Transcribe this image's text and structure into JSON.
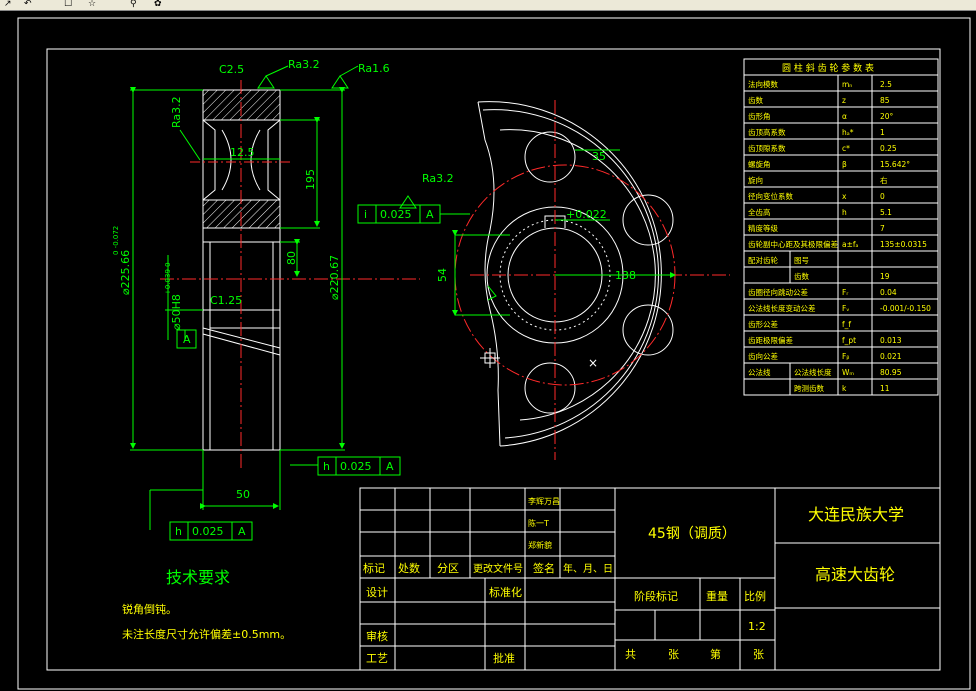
{
  "toolbar": {
    "icons": [
      "arrow-icon",
      "undo-icon",
      "checkbox-icon",
      "star-icon",
      "pin-icon",
      "palette-icon"
    ]
  },
  "colors": {
    "background": "#000000",
    "border": "#ffffff",
    "part": "#ffffff",
    "dimension": "#00ff00",
    "centerline": "#ff2a2a",
    "text": "#ffff00",
    "cyan": "#00ffff"
  },
  "dims": {
    "chamfer_top": "C2.5",
    "ra32_top": "Ra3.2",
    "ra16": "Ra1.6",
    "ra32_left": "Ra3.2",
    "d_12_5": "12.5",
    "d_195": "195",
    "d_80": "80",
    "d_220_67": "⌀220.67",
    "d_225_66": "⌀225.66",
    "d_225_66_tol": "0 -0.072",
    "d_50_bore": "⌀50H8",
    "d_50_tol": "+0.039 0",
    "chamfer_c125": "C1.25",
    "datum_a": "A",
    "d_50_width": "50",
    "fc1_symbol": "h",
    "fc1_value": "0.025",
    "fc1_datum": "A",
    "fc2_symbol": "h",
    "fc2_value": "0.025",
    "fc2_datum": "A",
    "fc3_symbol": "i",
    "fc3_value": "0.025",
    "fc3_datum": "A",
    "ra32_front": "Ra3.2",
    "d_35": "35",
    "d_54": "54",
    "d_138": "138",
    "d_keyway_tol": "+0.022"
  },
  "tech": {
    "title": "技术要求",
    "line1": "锐角倒钝。",
    "line2": "未注长度尺寸允许偏差±0.5mm。"
  },
  "params": {
    "title": "圆 柱 斜 齿 轮 参 数 表",
    "rows": [
      {
        "name": "法向模数",
        "sym": "mₙ",
        "val": "2.5"
      },
      {
        "name": "齿数",
        "sym": "z",
        "val": "85"
      },
      {
        "name": "齿形角",
        "sym": "α",
        "val": "20°"
      },
      {
        "name": "齿顶高系数",
        "sym": "hₐ*",
        "val": "1"
      },
      {
        "name": "齿顶隙系数",
        "sym": "c*",
        "val": "0.25"
      },
      {
        "name": "螺旋角",
        "sym": "β",
        "val": "15.642°"
      },
      {
        "name": "旋向",
        "sym": "",
        "val": "右"
      },
      {
        "name": "径向变位系数",
        "sym": "x",
        "val": "0"
      },
      {
        "name": "全齿高",
        "sym": "h",
        "val": "5.1"
      },
      {
        "name": "精度等级",
        "sym": "",
        "val": "7"
      },
      {
        "name": "齿轮副中心距及其极限偏差",
        "sym": "a±fₐ",
        "val": "135±0.0315"
      },
      {
        "name": "配对齿轮",
        "sub": "图号",
        "sym": "",
        "val": ""
      },
      {
        "name": "",
        "sub": "齿数",
        "sym": "",
        "val": "19"
      },
      {
        "name": "齿圈径向跳动公差",
        "sym": "Fᵣ",
        "val": "0.04"
      },
      {
        "name": "公法线长度变动公差",
        "sym": "Fᵥ",
        "val": "-0.001/-0.150"
      },
      {
        "name": "齿形公差",
        "sym": "f_f",
        "val": ""
      },
      {
        "name": "齿距极限偏差",
        "sym": "f_pt",
        "val": "0.013"
      },
      {
        "name": "齿向公差",
        "sym": "Fᵦ",
        "val": "0.021"
      },
      {
        "name": "公法线",
        "sub": "公法线长度",
        "sym": "Wₘ",
        "val": "80.95"
      },
      {
        "name": "",
        "sub": "跨测齿数",
        "sym": "k",
        "val": "11"
      }
    ]
  },
  "titleblock": {
    "material": "45钢（调质）",
    "school": "大连民族大学",
    "part_name": "高速大齿轮",
    "rev1": "李辉万昌",
    "rev2": "陈一T",
    "rev3": "郑新貌",
    "h_mark": "标记",
    "h_count": "处数",
    "h_zone": "分区",
    "h_docno": "更改文件号",
    "h_sign": "签名",
    "h_date": "年、月、日",
    "design": "设计",
    "standard": "标准化",
    "stage": "阶段标记",
    "weight": "重量",
    "scale": "比例",
    "scale_val": "1:2",
    "review": "审核",
    "process": "工艺",
    "approve": "批准",
    "total": "共",
    "sheets": "张",
    "no": "第",
    "sheet": "张"
  }
}
